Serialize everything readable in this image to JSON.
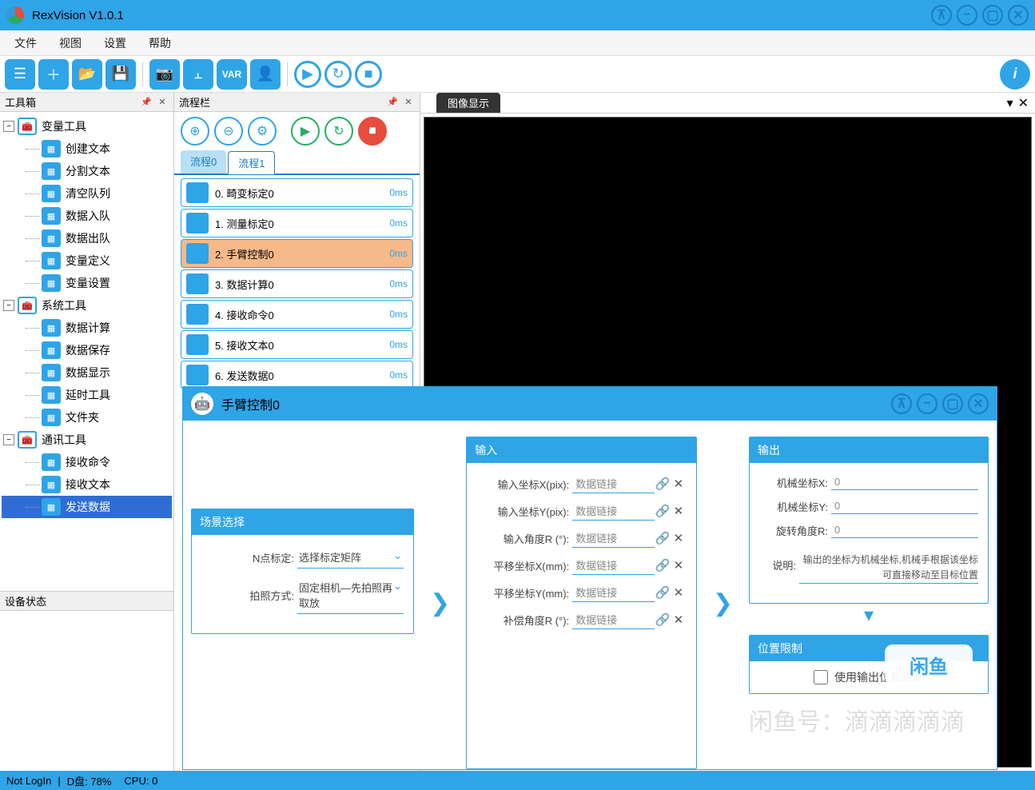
{
  "app": {
    "title": "RexVision V1.0.1"
  },
  "winControls": {
    "pin": "⊼",
    "min": "−",
    "max": "▢",
    "close": "✕"
  },
  "menus": [
    "文件",
    "视图",
    "设置",
    "帮助"
  ],
  "toolbar": {
    "var": "VAR"
  },
  "panels": {
    "toolbox": "工具箱",
    "process": "流程栏",
    "image": "图像显示",
    "device": "设备状态"
  },
  "tree": {
    "g1": {
      "label": "变量工具",
      "items": [
        "创建文本",
        "分割文本",
        "清空队列",
        "数据入队",
        "数据出队",
        "变量定义",
        "变量设置"
      ]
    },
    "g2": {
      "label": "系统工具",
      "items": [
        "数据计算",
        "数据保存",
        "数据显示",
        "延时工具",
        "文件夹"
      ]
    },
    "g3": {
      "label": "通讯工具",
      "items": [
        "接收命令",
        "接收文本",
        "发送数据"
      ]
    }
  },
  "treeSelected": "发送数据",
  "procTabs": [
    "流程0",
    "流程1"
  ],
  "procActiveTab": 1,
  "procItems": [
    {
      "name": "0. 畸变标定0",
      "time": "0ms"
    },
    {
      "name": "1. 测量标定0",
      "time": "0ms"
    },
    {
      "name": "2. 手臂控制0",
      "time": "0ms",
      "selected": true
    },
    {
      "name": "3. 数据计算0",
      "time": "0ms"
    },
    {
      "name": "4. 接收命令0",
      "time": "0ms"
    },
    {
      "name": "5. 接收文本0",
      "time": "0ms"
    },
    {
      "name": "6. 发送数据0",
      "time": "0ms"
    }
  ],
  "dialog": {
    "title": "手臂控制0",
    "scene": {
      "title": "场景选择",
      "nPointLabel": "N点标定:",
      "nPointValue": "选择标定矩阵",
      "shotLabel": "拍照方式:",
      "shotValue": "固定相机—先拍照再取放"
    },
    "input": {
      "title": "输入",
      "rows": [
        {
          "label": "输入坐标X(pix):",
          "value": "数据链接"
        },
        {
          "label": "输入坐标Y(pix):",
          "value": "数据链接"
        },
        {
          "label": "输入角度R  (°):",
          "value": "数据链接"
        },
        {
          "label": "平移坐标X(mm):",
          "value": "数据链接"
        },
        {
          "label": "平移坐标Y(mm):",
          "value": "数据链接"
        },
        {
          "label": "补偿角度R  (°):",
          "value": "数据链接"
        }
      ]
    },
    "output": {
      "title": "输出",
      "rows": [
        {
          "label": "机械坐标X:",
          "value": "0"
        },
        {
          "label": "机械坐标Y:",
          "value": "0"
        },
        {
          "label": "旋转角度R:",
          "value": "0"
        }
      ],
      "noteLabel": "说明:",
      "note": "输出的坐标为机械坐标,机械手根据该坐标可直接移动至目标位置"
    },
    "limit": {
      "title": "位置限制",
      "chk": "使用输出位置限制"
    }
  },
  "status": {
    "login": "Not LogIn",
    "disk": "D盘:  78%",
    "cpu": "CPU:  0"
  },
  "watermark": {
    "logo": "闲鱼",
    "text": "闲鱼号：滴滴滴滴滴"
  }
}
